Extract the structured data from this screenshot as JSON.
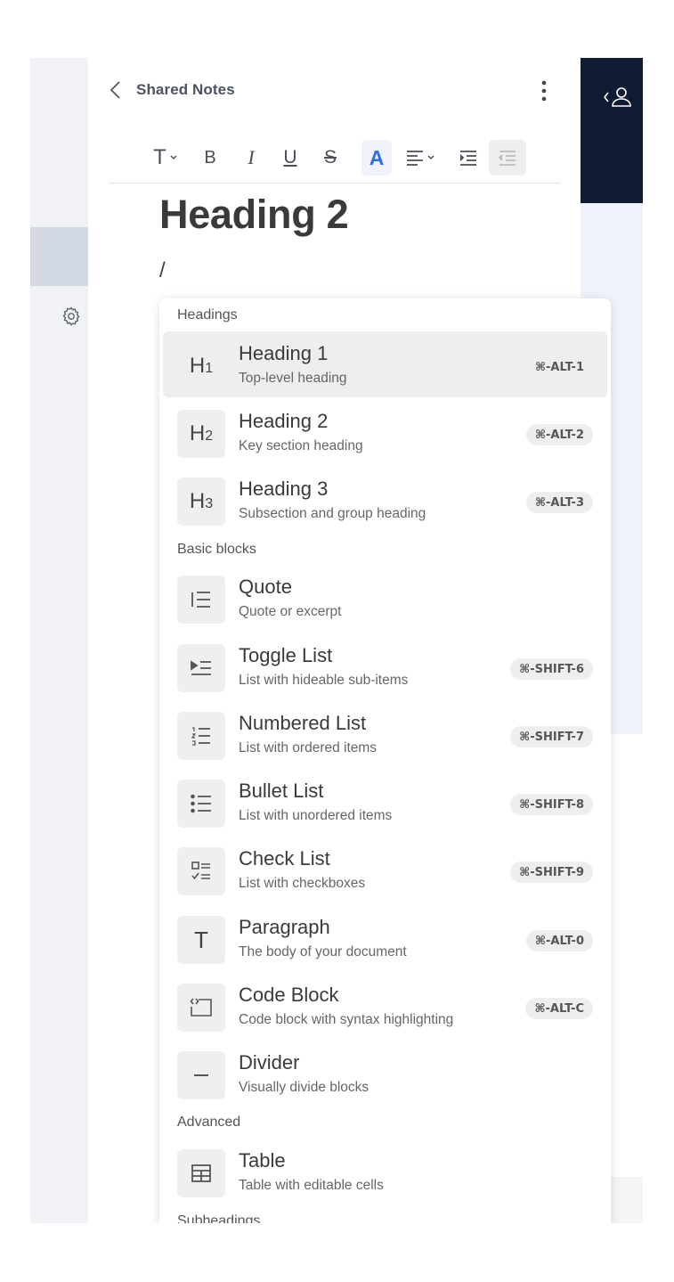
{
  "header": {
    "title": "Shared Notes"
  },
  "toolbar": {
    "text_type_icon": "T",
    "bold": "B",
    "italic": "I",
    "underline": "U",
    "strike": "S",
    "text_color": "A",
    "accent_color": "#2d6fe0"
  },
  "document": {
    "heading": "Heading 2",
    "slash": "/"
  },
  "menu": {
    "groups": [
      "Headings",
      "Basic blocks",
      "Advanced",
      "Subheadings"
    ],
    "items": [
      {
        "label": "Heading 1",
        "desc": "Top-level heading",
        "shortcut": "⌘-ALT-1",
        "icon": "H1",
        "icon_sub": "1"
      },
      {
        "label": "Heading 2",
        "desc": "Key section heading",
        "shortcut": "⌘-ALT-2",
        "icon": "H",
        "icon_sub": "2"
      },
      {
        "label": "Heading 3",
        "desc": "Subsection and group heading",
        "shortcut": "⌘-ALT-3",
        "icon": "H",
        "icon_sub": "3"
      },
      {
        "label": "Quote",
        "desc": "Quote or excerpt",
        "shortcut": ""
      },
      {
        "label": "Toggle List",
        "desc": "List with hideable sub-items",
        "shortcut": "⌘-SHIFT-6"
      },
      {
        "label": "Numbered List",
        "desc": "List with ordered items",
        "shortcut": "⌘-SHIFT-7"
      },
      {
        "label": "Bullet List",
        "desc": "List with unordered items",
        "shortcut": "⌘-SHIFT-8"
      },
      {
        "label": "Check List",
        "desc": "List with checkboxes",
        "shortcut": "⌘-SHIFT-9"
      },
      {
        "label": "Paragraph",
        "desc": "The body of your document",
        "shortcut": "⌘-ALT-0",
        "icon": "T"
      },
      {
        "label": "Code Block",
        "desc": "Code block with syntax highlighting",
        "shortcut": "⌘-ALT-C"
      },
      {
        "label": "Divider",
        "desc": "Visually divide blocks",
        "shortcut": ""
      },
      {
        "label": "Table",
        "desc": "Table with editable cells",
        "shortcut": ""
      }
    ]
  }
}
